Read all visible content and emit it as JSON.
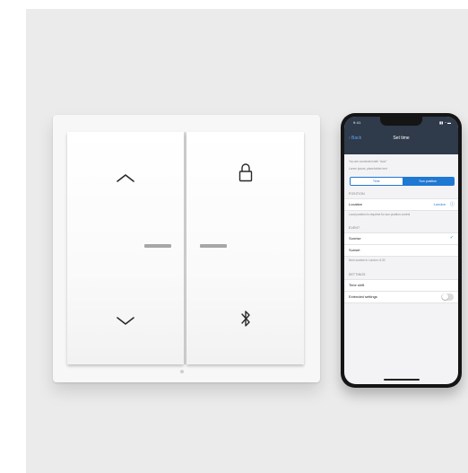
{
  "switch": {
    "left_rocker": {
      "top_icon": "chevron-up-icon",
      "bottom_icon": "chevron-down-icon"
    },
    "right_rocker": {
      "top_icon": "padlock-icon",
      "bottom_icon": "bluetooth-icon"
    },
    "indicator_color": "#a7a7a7"
  },
  "phone": {
    "status_time": "9:41",
    "status_icons": "▮▮ ◔ ▬",
    "back_label": "‹ Back",
    "title": "Set time",
    "info_connected": "You are connected with \"door\"",
    "info_hint": "Lorem ipsum, placeholder text",
    "segments": [
      {
        "label": "Time",
        "active": false
      },
      {
        "label": "Sun position",
        "active": true
      }
    ],
    "position": {
      "header": "POSITION",
      "location_label": "Location",
      "location_value": "London",
      "location_icon": "info-icon",
      "note": "Local position is required for sun position control"
    },
    "event": {
      "header": "EVENT",
      "sunrise_label": "Sunrise",
      "sunrise_checked": true,
      "sunset_label": "Sunset",
      "note": "Next sunrise in London: 6:30"
    },
    "settings": {
      "header": "SETTINGS",
      "time_shift_label": "Time shift",
      "extended_label": "Extended settings",
      "extended_on": false
    },
    "accent_color": "#1f78d1",
    "header_color": "#2f3a4a"
  }
}
